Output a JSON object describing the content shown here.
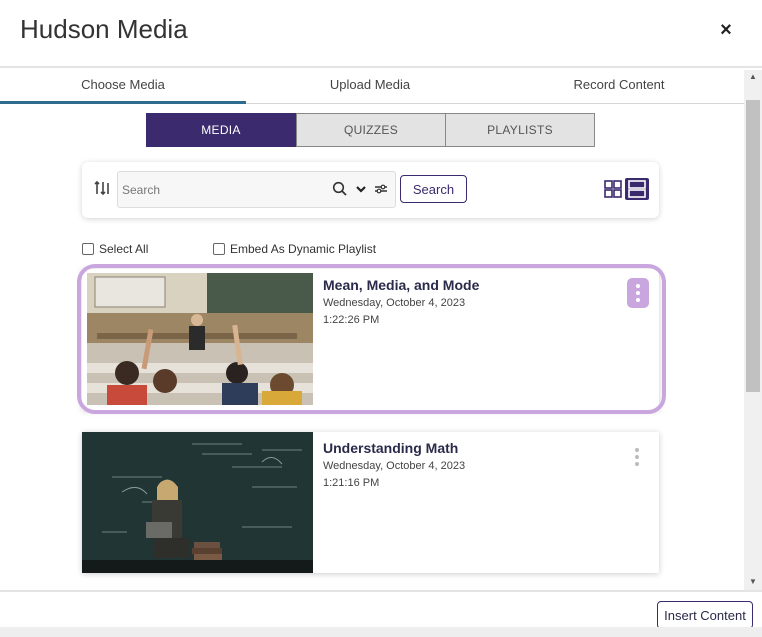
{
  "dialog": {
    "title": "Hudson Media",
    "close_symbol": "×"
  },
  "tabs": [
    {
      "label": "Choose Media",
      "active": true
    },
    {
      "label": "Upload Media",
      "active": false
    },
    {
      "label": "Record Content",
      "active": false
    }
  ],
  "segments": [
    {
      "label": "MEDIA",
      "active": true
    },
    {
      "label": "QUIZZES",
      "active": false
    },
    {
      "label": "PLAYLISTS",
      "active": false
    }
  ],
  "toolbar": {
    "search_placeholder": "Search",
    "search_button": "Search",
    "sort_icon": "sort-icon",
    "view_modes": [
      "grid-view-icon",
      "list-view-icon"
    ],
    "active_view": "list"
  },
  "options": {
    "select_all": "Select All",
    "embed_playlist": "Embed As Dynamic Playlist"
  },
  "media_items": [
    {
      "title": "Mean, Media, and Mode",
      "date": "Wednesday, October 4, 2023",
      "time": "1:22:26 PM",
      "selected": true
    },
    {
      "title": "Understanding Math",
      "date": "Wednesday, October 4, 2023",
      "time": "1:21:16 PM",
      "selected": false
    }
  ],
  "footer": {
    "insert_button": "Insert Content"
  },
  "colors": {
    "brand_purple": "#3b2a6d",
    "highlight_lilac": "#c9a6de",
    "tab_underline": "#2f6b8f"
  }
}
